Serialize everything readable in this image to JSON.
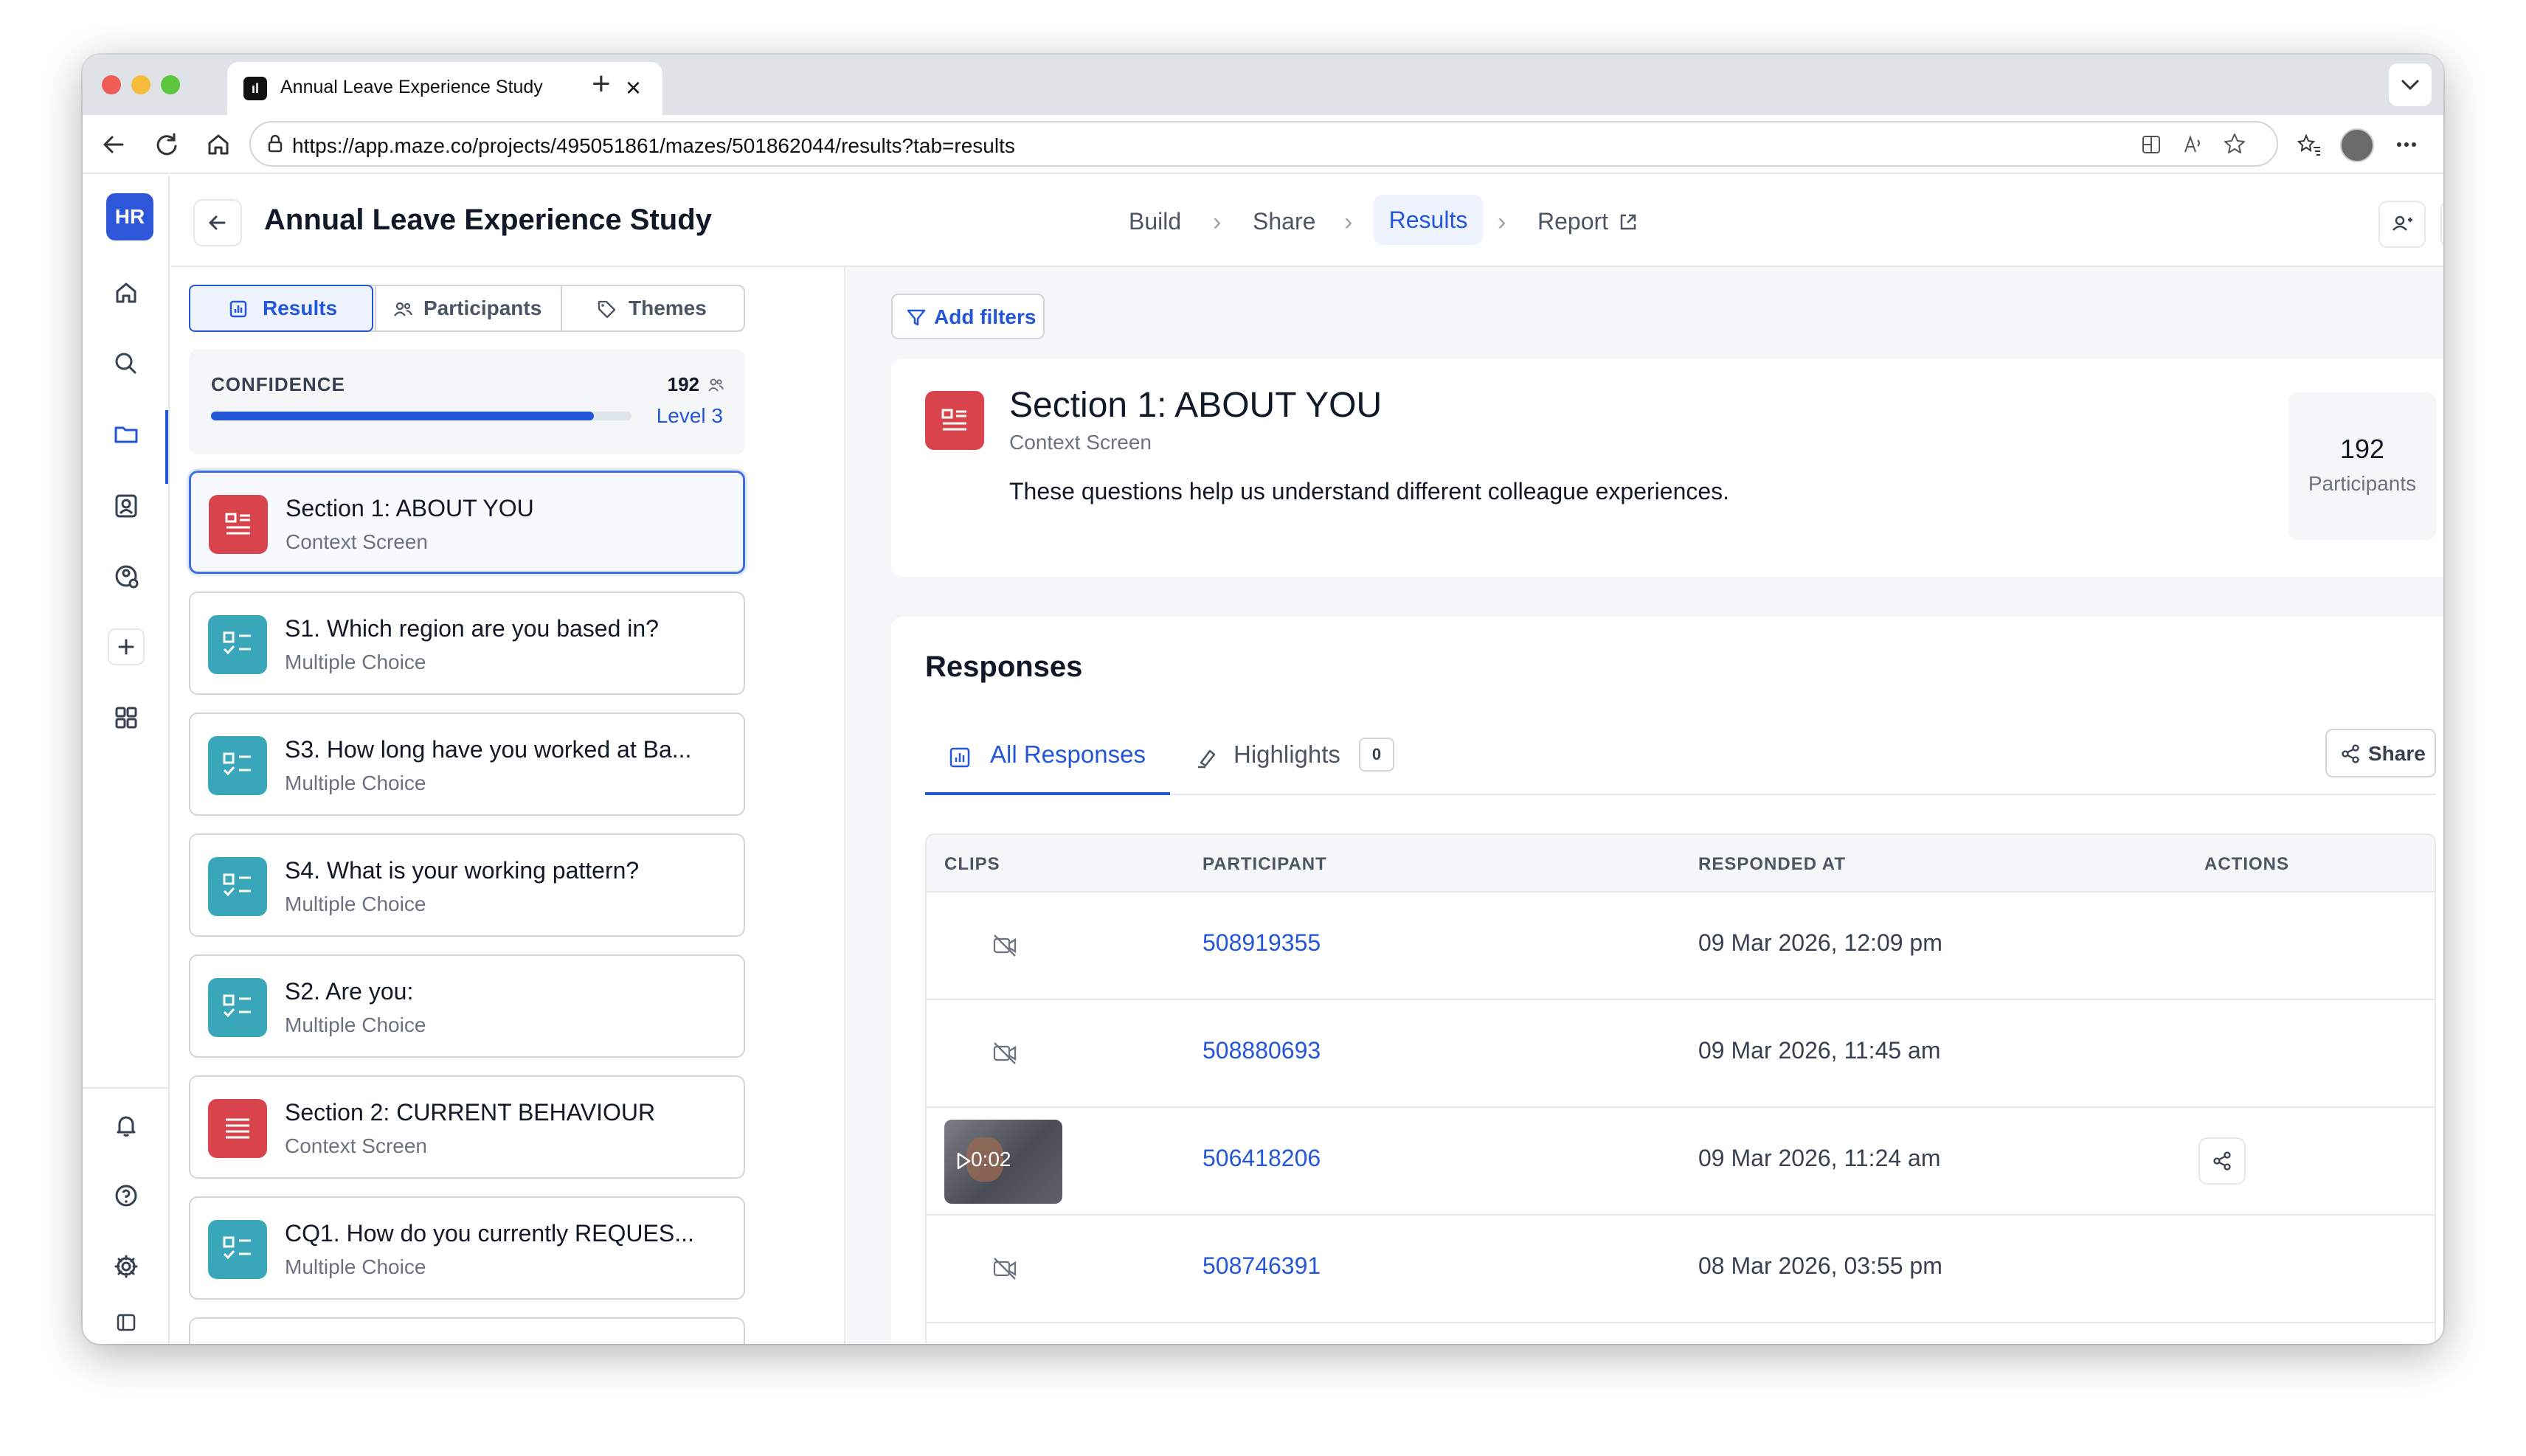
{
  "browser": {
    "tab_title": "Annual Leave Experience Study",
    "url": "https://app.maze.co/projects/495051861/mazes/501862044/results?tab=results"
  },
  "sidebar": {
    "logo": "HR",
    "icons": [
      "home-icon",
      "search-icon",
      "folder-icon",
      "contacts-icon",
      "user-settings-icon",
      "plus-icon",
      "apps-grid-icon",
      "bell-icon",
      "help-icon",
      "gear-icon",
      "collapse-sidebar-icon"
    ]
  },
  "header": {
    "title": "Annual Leave Experience Study",
    "steps": {
      "build": "Build",
      "share": "Share",
      "results": "Results",
      "report": "Report"
    }
  },
  "left_panel": {
    "tabs": {
      "results": "Results",
      "participants": "Participants",
      "themes": "Themes"
    },
    "confidence": {
      "label": "CONFIDENCE",
      "count": "192",
      "level": "Level 3",
      "progress": 0.91
    },
    "questions": [
      {
        "title": "Section 1: ABOUT YOU",
        "type": "Context Screen",
        "color": "red"
      },
      {
        "title": "S1. Which region are you based in?",
        "type": "Multiple Choice",
        "color": "teal"
      },
      {
        "title": "S3. How long have you worked at Ba...",
        "type": "Multiple Choice",
        "color": "teal"
      },
      {
        "title": "S4. What is your working pattern?",
        "type": "Multiple Choice",
        "color": "teal"
      },
      {
        "title": "S2. Are you:",
        "type": "Multiple Choice",
        "color": "teal"
      },
      {
        "title": "Section 2: CURRENT BEHAVIOUR",
        "type": "Context Screen",
        "color": "red"
      },
      {
        "title": "CQ1. How do you currently REQUES...",
        "type": "Multiple Choice",
        "color": "teal"
      }
    ]
  },
  "main": {
    "filters_label": "Add filters",
    "section": {
      "title": "Section 1: ABOUT YOU",
      "subtitle": "Context Screen",
      "description": "These questions help us understand different colleague experiences.",
      "participants_count": "192",
      "participants_label": "Participants"
    },
    "responses": {
      "title": "Responses",
      "tab_all": "All Responses",
      "tab_highlights": "Highlights",
      "highlights_count": "0",
      "share_label": "Share",
      "columns": {
        "clips": "CLIPS",
        "participant": "PARTICIPANT",
        "responded_at": "RESPONDED AT",
        "actions": "ACTIONS"
      },
      "rows": [
        {
          "participant": "508919355",
          "responded_at": "09 Mar 2026, 12:09 pm",
          "clip": null
        },
        {
          "participant": "508880693",
          "responded_at": "09 Mar 2026, 11:45 am",
          "clip": null
        },
        {
          "participant": "506418206",
          "responded_at": "09 Mar 2026, 11:24 am",
          "clip": "0:02"
        },
        {
          "participant": "508746391",
          "responded_at": "08 Mar 2026, 03:55 pm",
          "clip": null
        }
      ]
    }
  },
  "colors": {
    "accent": "#2456d8",
    "context_screen": "#d9434b",
    "multiple_choice": "#3aa6b9"
  }
}
